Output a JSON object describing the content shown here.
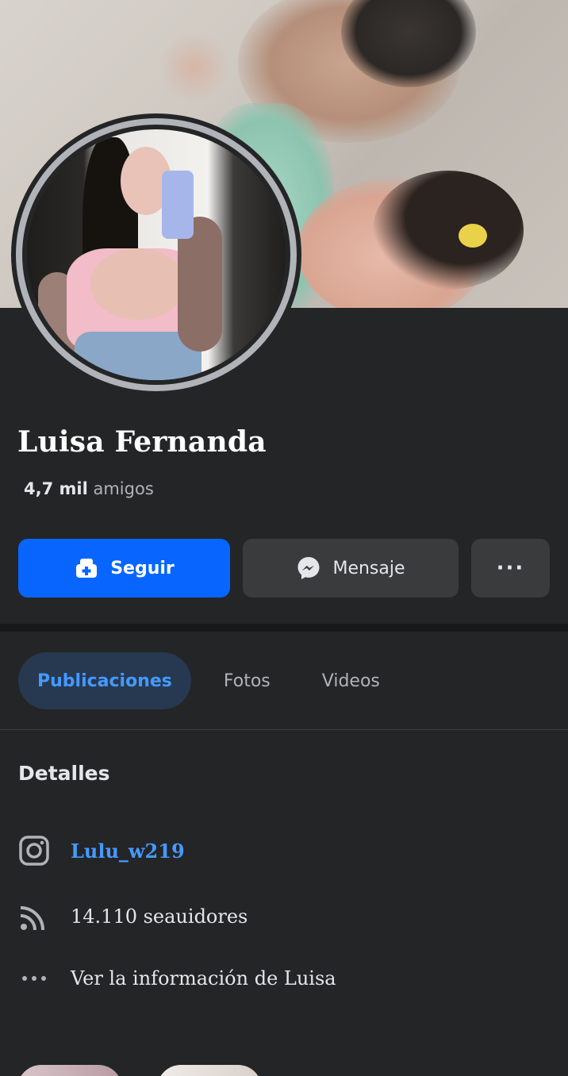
{
  "profile": {
    "name": "Luisa Fernanda",
    "friends_count": "4,7 mil",
    "friends_label": "amigos"
  },
  "actions": {
    "follow_label": "Seguir",
    "message_label": "Mensaje",
    "more_label": "···"
  },
  "tabs": [
    {
      "label": "Publicaciones",
      "active": true
    },
    {
      "label": "Fotos",
      "active": false
    },
    {
      "label": "Videos",
      "active": false
    }
  ],
  "details": {
    "title": "Detalles",
    "instagram": "Lulu_w219",
    "followers": "14.110 seauidores",
    "more_info": "Ver la información de Luisa"
  },
  "icons": {
    "follow": "add-friend-icon",
    "message": "messenger-icon",
    "instagram": "instagram-icon",
    "followers": "rss-icon",
    "more": "ellipsis-icon"
  },
  "colors": {
    "background": "#242526",
    "accent": "#0866ff",
    "link": "#4599ff",
    "secondary_button": "#3a3b3c"
  }
}
